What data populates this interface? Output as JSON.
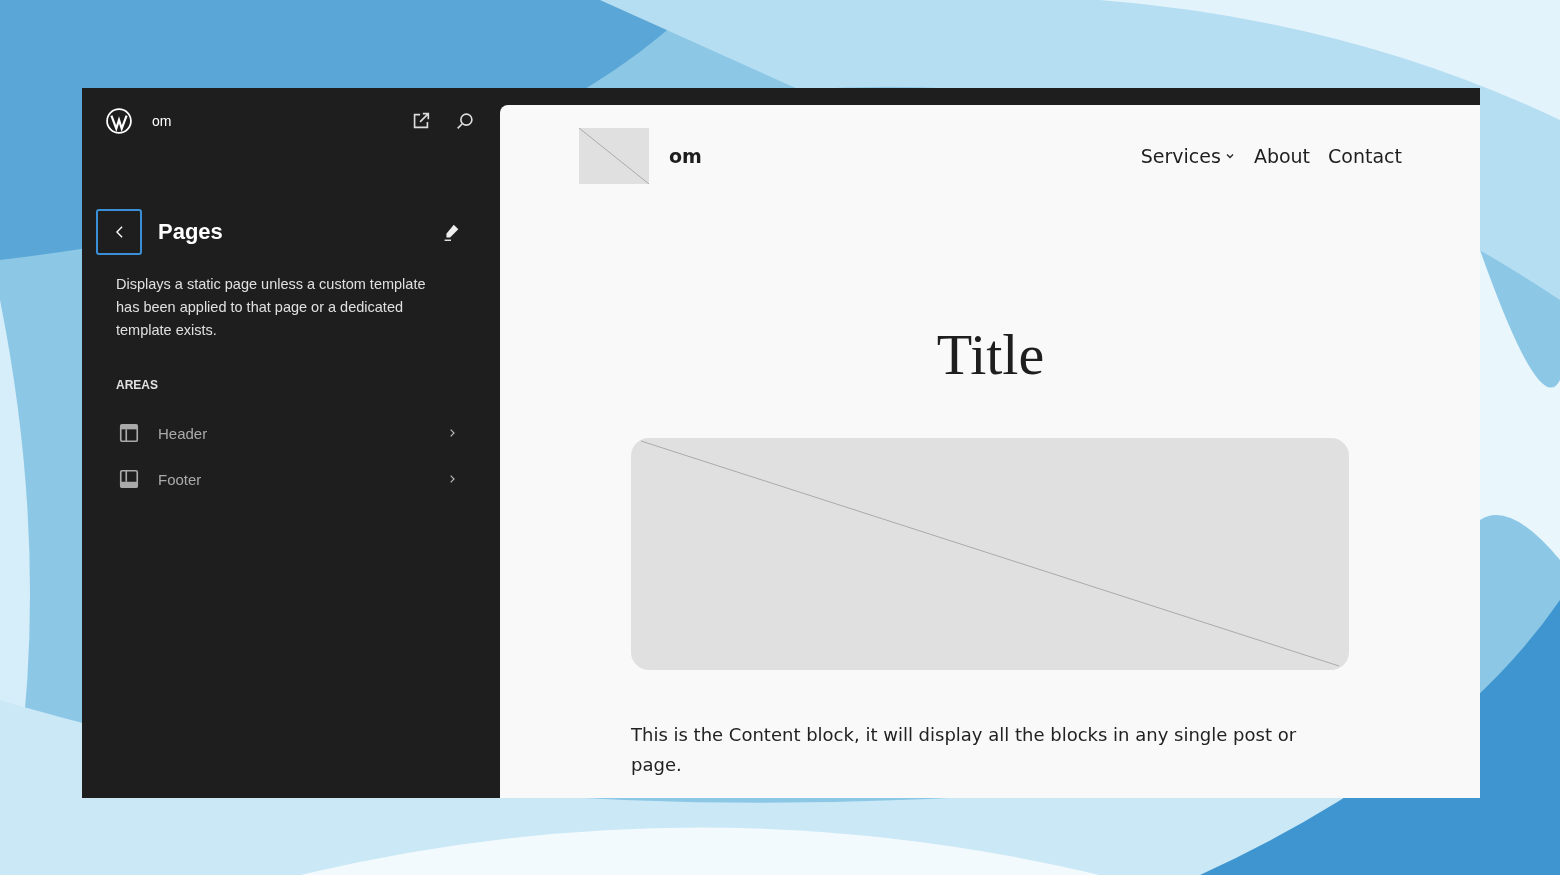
{
  "sidebar": {
    "site_title": "om",
    "heading": "Pages",
    "description": "Displays a static page unless a custom template has been applied to that page or a dedicated template exists.",
    "section_label": "AREAS",
    "areas": [
      {
        "label": "Header",
        "kind": "header"
      },
      {
        "label": "Footer",
        "kind": "footer"
      }
    ]
  },
  "preview": {
    "site_title": "om",
    "nav": [
      {
        "label": "Services",
        "kind": "dropdown"
      },
      {
        "label": "About",
        "kind": "link"
      },
      {
        "label": "Contact",
        "kind": "link"
      }
    ],
    "title": "Title",
    "content": "This is the Content block, it will display all the blocks in any single post or page."
  }
}
